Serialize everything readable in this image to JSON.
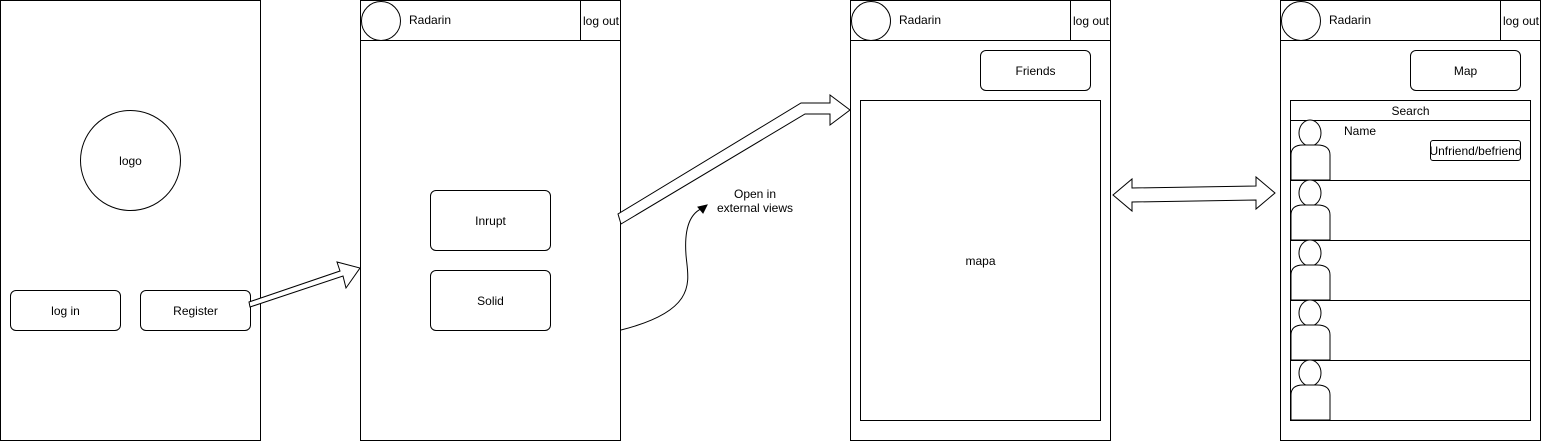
{
  "screen_login": {
    "logo_label": "logo",
    "login_button": "log in",
    "register_button": "Register"
  },
  "screen_provider": {
    "app_title": "Radarin",
    "logout_button": "log out",
    "inrupt_button": "Inrupt",
    "solid_button": "Solid"
  },
  "annotation": {
    "external_views": "Open in\nexternal views"
  },
  "screen_map": {
    "app_title": "Radarin",
    "logout_button": "log out",
    "friends_button": "Friends",
    "map_label": "mapa"
  },
  "screen_friends": {
    "app_title": "Radarin",
    "logout_button": "log out",
    "map_button": "Map",
    "search_label": "Search",
    "first_row_name": "Name",
    "first_row_action": "Unfriend/befriend",
    "row_count_visible": 5
  },
  "icons": {
    "avatar": "circle-avatar-icon",
    "person": "person-silhouette-icon",
    "arrow": "block-arrow-icon",
    "curve_arrow": "curved-arrow-icon"
  }
}
